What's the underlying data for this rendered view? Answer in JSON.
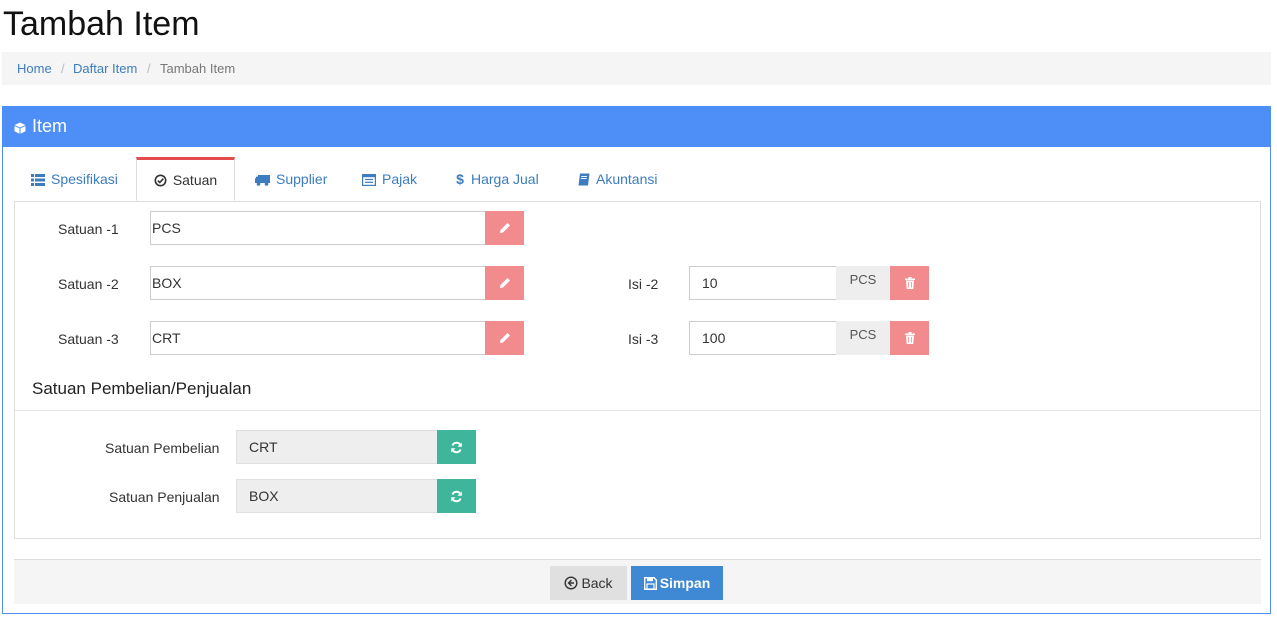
{
  "page": {
    "title": "Tambah Item"
  },
  "breadcrumb": {
    "home": "Home",
    "sep": "/",
    "list": "Daftar Item",
    "current": "Tambah Item"
  },
  "panel": {
    "title": "Item",
    "accent": "#4d8ef7"
  },
  "tabs": [
    {
      "label": "Spesifikasi",
      "icon": "list-icon"
    },
    {
      "label": "Satuan",
      "icon": "check-circle-icon",
      "active": true
    },
    {
      "label": "Supplier",
      "icon": "truck-icon"
    },
    {
      "label": "Pajak",
      "icon": "table-icon"
    },
    {
      "label": "Harga Jual",
      "icon": "dollar-icon"
    },
    {
      "label": "Akuntansi",
      "icon": "book-icon"
    }
  ],
  "satuan": [
    {
      "label": "Satuan -1",
      "value": "PCS"
    },
    {
      "label": "Satuan -2",
      "value": "BOX",
      "isi_label": "Isi -2",
      "isi_value": "10",
      "isi_unit": "PCS"
    },
    {
      "label": "Satuan -3",
      "value": "CRT",
      "isi_label": "Isi -3",
      "isi_value": "100",
      "isi_unit": "PCS"
    }
  ],
  "section": {
    "title": "Satuan Pembelian/Penjualan",
    "pembelian_label": "Satuan Pembelian",
    "pembelian_value": "CRT",
    "penjualan_label": "Satuan Penjualan",
    "penjualan_value": "BOX"
  },
  "footer": {
    "back_label": "Back",
    "save_label": "Simpan"
  },
  "colors": {
    "danger": "#f28b8e",
    "teal": "#3fb59b",
    "primary": "#3f88d3"
  }
}
